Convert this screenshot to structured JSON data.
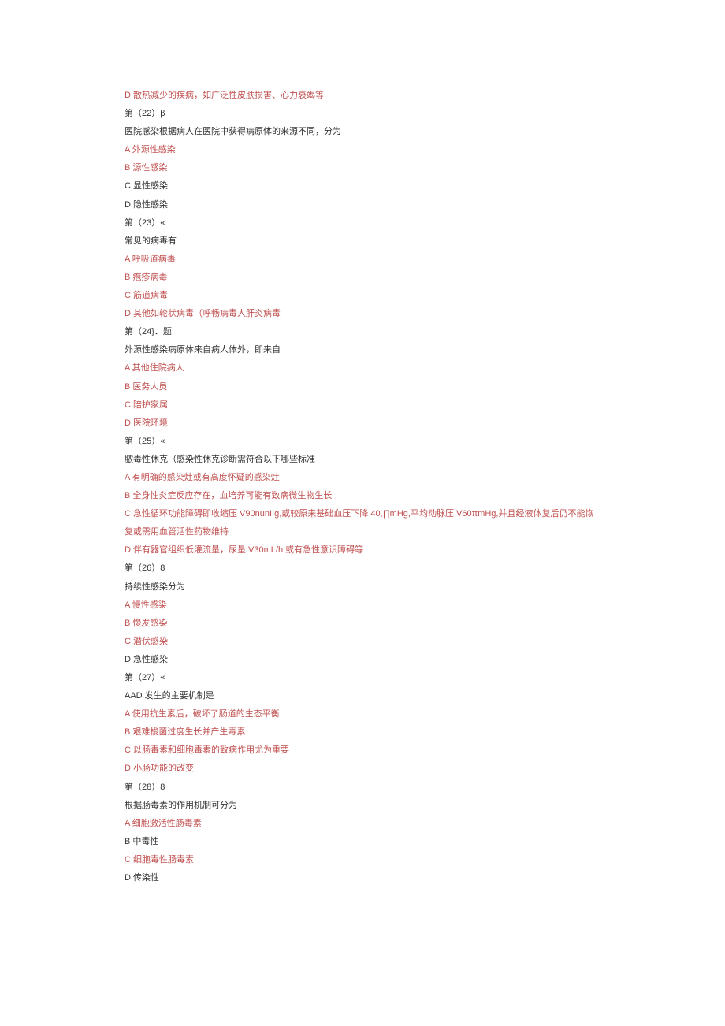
{
  "lines": [
    {
      "text": "D 散热减少的疾病，如广泛性皮肤损害、心力衰竭等",
      "cls": "red"
    },
    {
      "text": "第（22）β",
      "cls": "black"
    },
    {
      "text": "医院感染根据病人在医院中获得病原体的来源不同，分为",
      "cls": "black"
    },
    {
      "text": "A 外源性感染",
      "cls": "red"
    },
    {
      "text": "B 源性感染",
      "cls": "red"
    },
    {
      "text": "C 显性感染",
      "cls": "black"
    },
    {
      "text": "D 隐性感染",
      "cls": "black"
    },
    {
      "text": "第（23）«",
      "cls": "black"
    },
    {
      "text": "常见的病毒有",
      "cls": "black"
    },
    {
      "text": "A 呼吸道病毒",
      "cls": "red"
    },
    {
      "text": "B 疱疹病毒",
      "cls": "red"
    },
    {
      "text": "C 筋道病毒",
      "cls": "red"
    },
    {
      "text": "D 其他如轮状病毒（呼畅病毒人肝炎病毒",
      "cls": "red"
    },
    {
      "text": "第（24}．题",
      "cls": "black"
    },
    {
      "text": "外源性感染病原体来自病人体外，即来自",
      "cls": "black"
    },
    {
      "text": "A 其他住院病人",
      "cls": "red"
    },
    {
      "text": "B 医务人员",
      "cls": "red"
    },
    {
      "text": "C 陪护家属",
      "cls": "red"
    },
    {
      "text": "D 医院环境",
      "cls": "red"
    },
    {
      "text": "第（25）«",
      "cls": "black"
    },
    {
      "text": "脓毒性休克（感染性休克诊断需符合以下哪些标准",
      "cls": "black"
    },
    {
      "text": "A 有明确的感染灶或有高度怀疑的感染灶",
      "cls": "red"
    },
    {
      "text": "B 全身性炎症反应存在，血培养可能有致病微生物生长",
      "cls": "red"
    },
    {
      "text": "C.急性循环功能障碍即收缩压 V90nunIIg,或较原来基础血压下降 40,∏mHg,平均动脉压 V60πmHg,并且经液体复后仍不能恢复或需用血管活性药物维持",
      "cls": "red"
    },
    {
      "text": "D 伴有器官组织低灌流量，尿量 V30mL/h.或有急性意识障碍等",
      "cls": "red"
    },
    {
      "text": "第（26）8",
      "cls": "black"
    },
    {
      "text": "持续性感染分为",
      "cls": "black"
    },
    {
      "text": "A 慢性感染",
      "cls": "red"
    },
    {
      "text": "B 慢发感染",
      "cls": "red"
    },
    {
      "text": "C 潜伏感染",
      "cls": "red"
    },
    {
      "text": "D 急性感染",
      "cls": "black"
    },
    {
      "text": "第（27）«",
      "cls": "black"
    },
    {
      "text": "AAD 发生的主要机制是",
      "cls": "black"
    },
    {
      "text": "A 使用抗生素后，破坏了肠道的生态平衡",
      "cls": "red"
    },
    {
      "text": "B 艰难梭菌过度生长并产生毒素",
      "cls": "red"
    },
    {
      "text": "C 以肠毒素和细胞毒素的致病作用尤为重要",
      "cls": "red"
    },
    {
      "text": "D 小肠功能的改变",
      "cls": "red"
    },
    {
      "text": "第（28）8",
      "cls": "black"
    },
    {
      "text": "根据肠毒素的作用机制可分为",
      "cls": "black"
    },
    {
      "text": "A 细胞激活性肠毒素",
      "cls": "red"
    },
    {
      "text": "B 中毒性",
      "cls": "black"
    },
    {
      "text": "C 细胞毒性肠毒素",
      "cls": "red"
    },
    {
      "text": "D 传染性",
      "cls": "black"
    }
  ]
}
